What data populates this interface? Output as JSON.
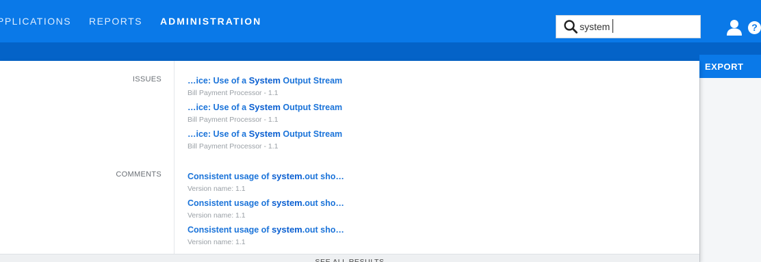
{
  "nav": {
    "items": [
      {
        "label": "PPLICATIONS"
      },
      {
        "label": "REPORTS"
      },
      {
        "label": "ADMINISTRATION"
      }
    ]
  },
  "search": {
    "value": "system",
    "icon": "search-icon"
  },
  "header_icons": {
    "user": "user-icon",
    "help": "help-icon",
    "help_glyph": "?"
  },
  "export": {
    "label": "EXPORT"
  },
  "results": {
    "issues": {
      "label": "ISSUES",
      "items": [
        {
          "pre": "…ice: Use of a ",
          "hl": "System",
          "post": " Output Stream",
          "sub": "Bill Payment Processor - 1.1"
        },
        {
          "pre": "…ice: Use of a ",
          "hl": "System",
          "post": " Output Stream",
          "sub": "Bill Payment Processor - 1.1"
        },
        {
          "pre": "…ice: Use of a ",
          "hl": "System",
          "post": " Output Stream",
          "sub": "Bill Payment Processor - 1.1"
        }
      ]
    },
    "comments": {
      "label": "COMMENTS",
      "items": [
        {
          "pre": "Consistent usage of ",
          "hl": "system",
          "post": ".out sho…",
          "sub": "Version name: 1.1"
        },
        {
          "pre": "Consistent usage of ",
          "hl": "system",
          "post": ".out sho…",
          "sub": "Version name: 1.1"
        },
        {
          "pre": "Consistent usage of ",
          "hl": "system",
          "post": ".out sho…",
          "sub": "Version name: 1.1"
        }
      ]
    },
    "see_all": "SEE ALL RESULTS"
  },
  "colors": {
    "nav_bar": "#0a79e8",
    "sub_bar": "#0463c8",
    "link": "#1a73d9"
  }
}
